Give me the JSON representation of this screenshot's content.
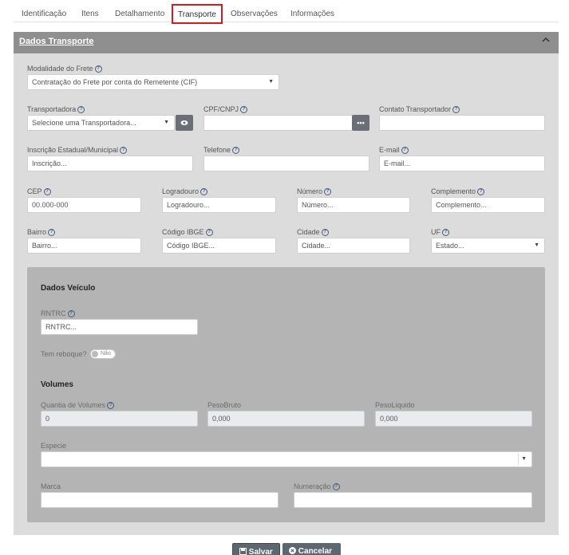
{
  "tabs": [
    {
      "label": "Identificação"
    },
    {
      "label": "Itens"
    },
    {
      "label": "Detalhamento"
    },
    {
      "label": "Transporte",
      "active": true
    },
    {
      "label": "Observações"
    },
    {
      "label": "Informações"
    }
  ],
  "panel": {
    "title": "Dados Transporte",
    "collapse_icon": "chevron-up-icon"
  },
  "freight": {
    "label": "Modalidade do Frete",
    "value": "Contratação do Frete por conta do Remetente (CIF)"
  },
  "carrier": {
    "label": "Transportadora",
    "placeholder": "Selecione uma Transportadora...",
    "view_icon": "eye-icon"
  },
  "cpf": {
    "label": "CPF/CNPJ",
    "value": "",
    "button_label": "•••"
  },
  "contact": {
    "label": "Contato Transportador",
    "value": ""
  },
  "state_registration": {
    "label": "Inscrição Estadual/Municipal",
    "placeholder": "Inscrição..."
  },
  "phone": {
    "label": "Telefone",
    "value": ""
  },
  "email": {
    "label": "E-mail",
    "placeholder": "E-mail..."
  },
  "cep": {
    "label": "CEP",
    "placeholder": "00.000-000"
  },
  "street": {
    "label": "Logradouro",
    "placeholder": "Logradouro..."
  },
  "number": {
    "label": "Número",
    "placeholder": "Número..."
  },
  "complement": {
    "label": "Complemento",
    "placeholder": "Complemento..."
  },
  "district": {
    "label": "Bairro",
    "placeholder": "Bairro..."
  },
  "ibge": {
    "label": "Código IBGE",
    "placeholder": "Código IBGE..."
  },
  "city": {
    "label": "Cidade",
    "placeholder": "Cidade..."
  },
  "uf": {
    "label": "UF",
    "placeholder": "Estado..."
  },
  "vehicle": {
    "title": "Dados Veículo",
    "rntrc_label": "RNTRC",
    "rntrc_placeholder": "RNTRC...",
    "trailer_label": "Tem reboque?",
    "trailer_toggle": "Não"
  },
  "volumes": {
    "title": "Volumes",
    "quantity_label": "Quantia de Volumes",
    "quantity_value": "0",
    "gross_label": "PesoBruto",
    "gross_value": "0,000",
    "net_label": "PesoLiquido",
    "net_value": "0,000",
    "species_label": "Especie",
    "species_value": "",
    "brand_label": "Marca",
    "brand_value": "",
    "numbering_label": "Numeração",
    "numbering_value": ""
  },
  "footer": {
    "save_label": "Salvar",
    "cancel_label": "Cancelar",
    "save_icon": "floppy-disk-icon",
    "cancel_icon": "x-circle-icon"
  },
  "colors": {
    "active_tab_border": "#d9191a",
    "panel_header": "#8f8f8f",
    "panel_body": "#dcdcdc",
    "vehicle_box": "#b4b4b4",
    "button_dark": "#5c6770"
  }
}
